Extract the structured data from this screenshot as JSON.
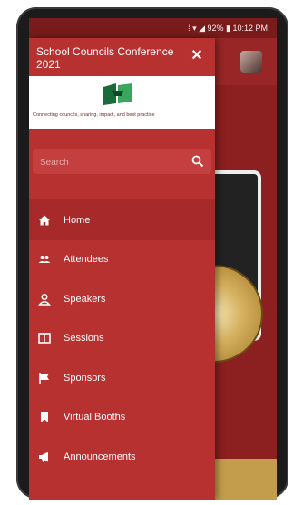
{
  "status_bar": {
    "text": "⁞ ▾ ◢ 92% ▮ 10:12 PM"
  },
  "drawer": {
    "title": "School Councils Conference 2021",
    "tagline": "Connecting councils, sharing, impact, and best practice",
    "search_placeholder": "Search",
    "items": [
      {
        "label": "Home",
        "icon": "home-icon",
        "active": true
      },
      {
        "label": "Attendees",
        "icon": "people-icon"
      },
      {
        "label": "Speakers",
        "icon": "person-icon"
      },
      {
        "label": "Sessions",
        "icon": "book-icon"
      },
      {
        "label": "Sponsors",
        "icon": "flag-icon"
      },
      {
        "label": "Virtual Booths",
        "icon": "bookmark-icon"
      },
      {
        "label": "Announcements",
        "icon": "megaphone-icon"
      }
    ]
  },
  "colors": {
    "drawer_bg": "#b83131",
    "active_item": "#a72929",
    "app_bar": "#982626"
  }
}
